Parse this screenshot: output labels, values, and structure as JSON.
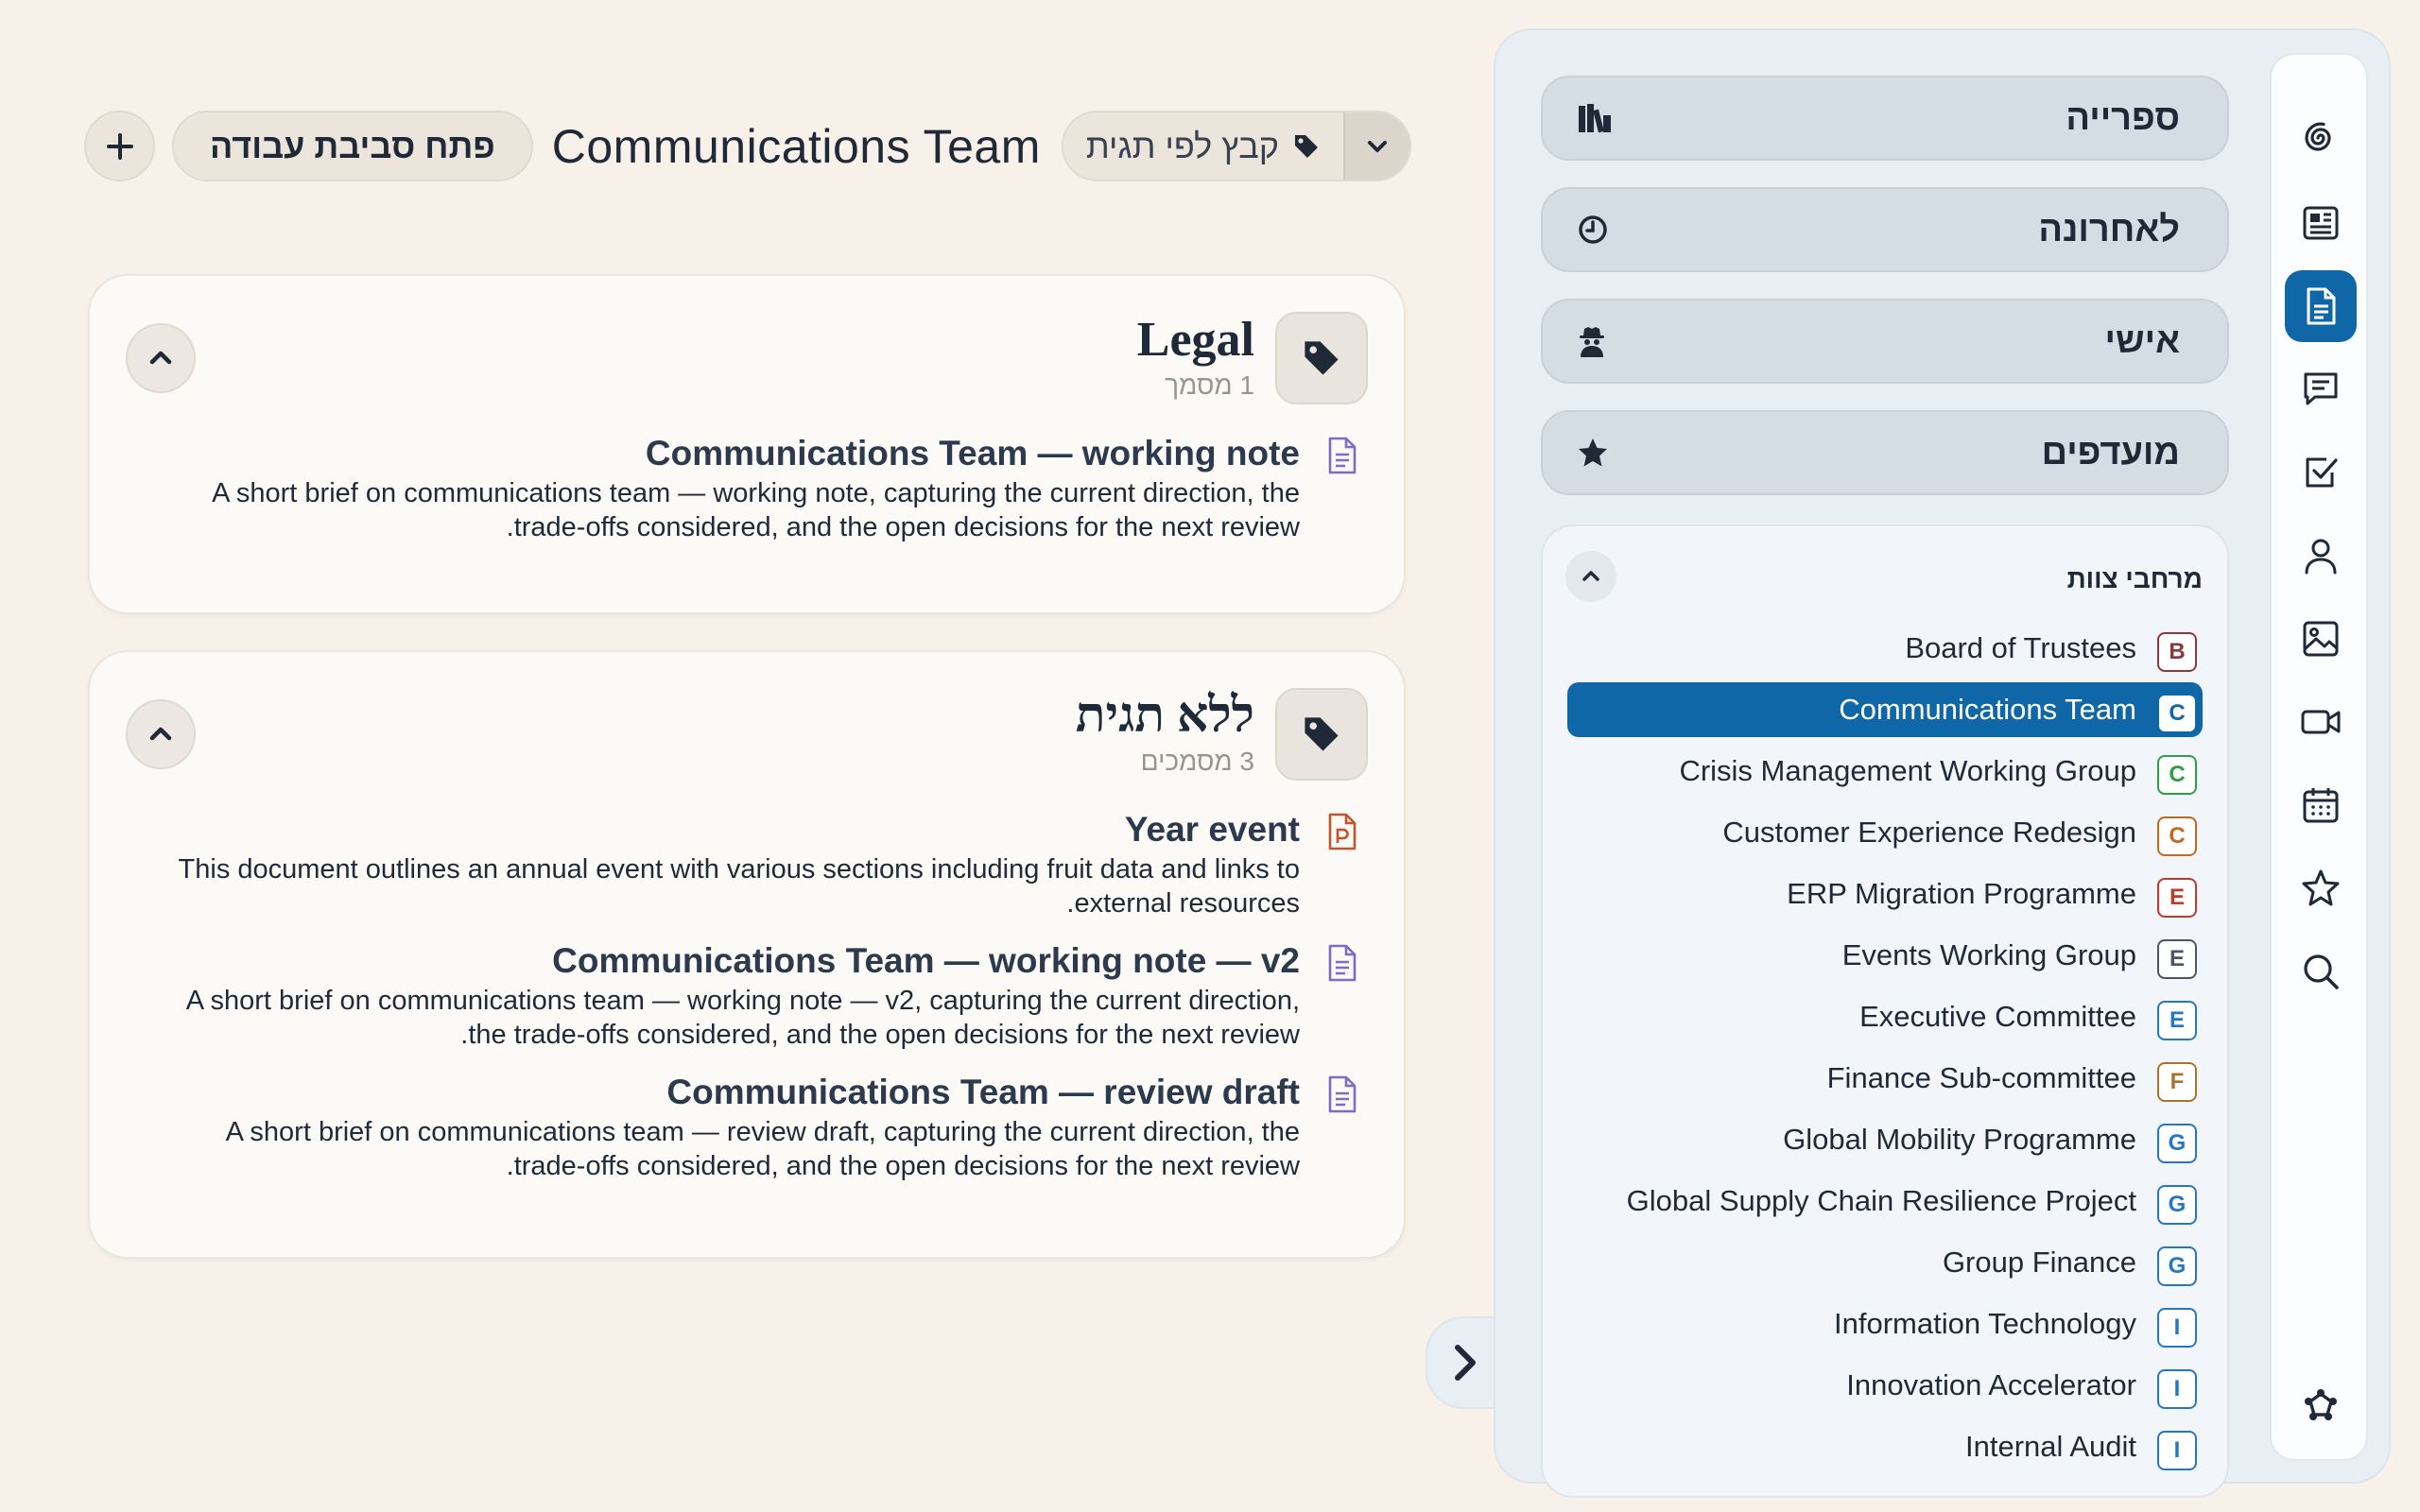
{
  "header": {
    "add_icon": "plus-icon",
    "open_workspace_label": "פתח סביבת עבודה",
    "team_title": "Communications Team",
    "group_by_label": "קבץ לפי תגית",
    "group_by_icon": "tag-icon",
    "group_by_toggle_icon": "chevron-down-icon"
  },
  "groups": [
    {
      "title": "Legal",
      "count": "1 מסמך",
      "docs": [
        {
          "title": "Communications Team — working note",
          "description": "A short brief on communications team — working note, capturing the current direction, the trade-offs considered, and the open decisions for the next review.",
          "icon": "document-icon"
        }
      ]
    },
    {
      "title": "ללא תגית",
      "count": "3 מסמכים",
      "docs": [
        {
          "title": "Year event",
          "description": "This document outlines an annual event with various sections including fruit data and links to external resources.",
          "icon": "presentation-icon"
        },
        {
          "title": "Communications Team — working note — v2",
          "description": "A short brief on communications team — working note — v2, capturing the current direction, the trade-offs considered, and the open decisions for the next review.",
          "icon": "document-icon"
        },
        {
          "title": "Communications Team — review draft",
          "description": "A short brief on communications team — review draft, capturing the current direction, the trade-offs considered, and the open decisions for the next review.",
          "icon": "document-icon"
        }
      ]
    }
  ],
  "sidebar": {
    "nav": [
      {
        "label": "ספרייה",
        "icon": "books-icon"
      },
      {
        "label": "לאחרונה",
        "icon": "clock-icon"
      },
      {
        "label": "אישי",
        "icon": "user-secret-icon"
      },
      {
        "label": "מועדפים",
        "icon": "star-icon"
      }
    ],
    "workspaces_label": "מרחבי צוות",
    "workspaces": [
      {
        "name": "Board of Trustees",
        "badge": "B",
        "color": "#8b3a3a",
        "active": false
      },
      {
        "name": "Communications Team",
        "badge": "C",
        "color": "#0f67a8",
        "active": true
      },
      {
        "name": "Crisis Management Working Group",
        "badge": "C",
        "color": "#2f9e4a",
        "active": false
      },
      {
        "name": "Customer Experience Redesign",
        "badge": "C",
        "color": "#c2691e",
        "active": false
      },
      {
        "name": "ERP Migration Programme",
        "badge": "E",
        "color": "#c0392b",
        "active": false
      },
      {
        "name": "Events Working Group",
        "badge": "E",
        "color": "#4b5563",
        "active": false
      },
      {
        "name": "Executive Committee",
        "badge": "E",
        "color": "#2477c4",
        "active": false
      },
      {
        "name": "Finance Sub-committee",
        "badge": "F",
        "color": "#a8742c",
        "active": false
      },
      {
        "name": "Global Mobility Programme",
        "badge": "G",
        "color": "#2477c4",
        "active": false
      },
      {
        "name": "Global Supply Chain Resilience Project",
        "badge": "G",
        "color": "#2477c4",
        "active": false
      },
      {
        "name": "Group Finance",
        "badge": "G",
        "color": "#2477c4",
        "active": false
      },
      {
        "name": "Information Technology",
        "badge": "I",
        "color": "#2477c4",
        "active": false
      },
      {
        "name": "Innovation Accelerator",
        "badge": "I",
        "color": "#2477c4",
        "active": false
      },
      {
        "name": "Internal Audit",
        "badge": "I",
        "color": "#2477c4",
        "active": false
      }
    ],
    "rail_icons": [
      "spiral-logo-icon",
      "newspaper-icon",
      "document-icon",
      "chat-icon",
      "checkbox-icon",
      "user-icon",
      "image-icon",
      "video-icon",
      "calendar-icon",
      "star-icon",
      "search-icon"
    ],
    "rail_bottom_icon": "settings-icon",
    "expand_icon": "chevron-right-icon"
  },
  "colors": {
    "accent": "#0f67a8",
    "background": "#f7f1ea",
    "panel": "#e7eef4",
    "doc_icon": "#7c6cc4",
    "ppt_icon": "#c2562a"
  }
}
